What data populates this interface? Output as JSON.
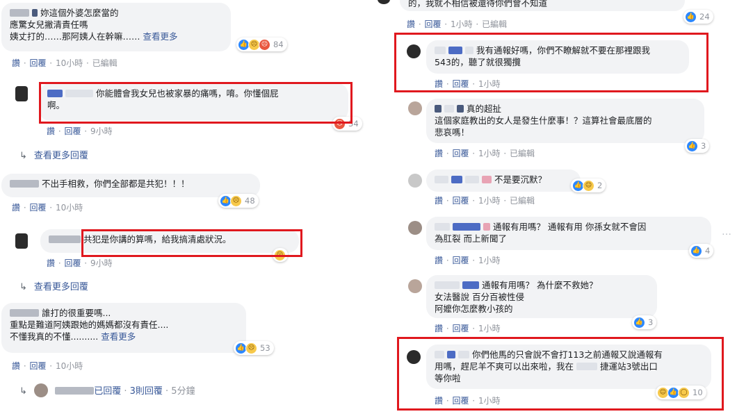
{
  "left": {
    "c1": {
      "lines": [
        "妳這個外婆怎麼當的",
        "應驚女兒撇清責任嗎",
        "姨丈打的……那阿姨人在幹嘛……"
      ],
      "see_more": "查看更多",
      "reaction_count": "84",
      "actions": {
        "like": "讚",
        "reply": "回覆",
        "time": "10小時",
        "edited": "已編輯"
      }
    },
    "c2": {
      "lines": [
        "你能體會我女兒也被家暴的痛嗎，唷。你懂個屁",
        "啊。"
      ],
      "reaction_count": "34",
      "actions": {
        "like": "讚",
        "reply": "回覆",
        "time": "9小時"
      }
    },
    "more1": {
      "label": "查看更多回覆"
    },
    "c3": {
      "lines": [
        "不出手相救，你們全部都是共犯！！！"
      ],
      "reaction_count": "48",
      "actions": {
        "like": "讚",
        "reply": "回覆",
        "time": "10小時"
      }
    },
    "c4": {
      "lines": [
        "共犯是你講的算嗎，給我搞清處狀況。"
      ],
      "actions": {
        "like": "讚",
        "reply": "回覆",
        "time": "9小時"
      }
    },
    "more2": {
      "label": "查看更多回覆"
    },
    "c5": {
      "lines": [
        "誰打的很重要嗎...",
        "重點是難道阿姨跟她的媽媽都沒有責任....",
        "不懂我真的不懂.........."
      ],
      "see_more": "查看更多",
      "reaction_count": "53",
      "actions": {
        "like": "讚",
        "reply": "回覆",
        "time": "10小時"
      }
    },
    "replies": {
      "text": "已回覆",
      "count": "3則回覆",
      "time": "5分鐘"
    }
  },
  "right": {
    "c0": {
      "lines": [
        "的，我就不相信被還待你們會不知道"
      ],
      "reaction_count": "24",
      "actions": {
        "like": "讚",
        "reply": "回覆",
        "time": "1小時",
        "edited": "已編輯"
      }
    },
    "c1": {
      "lines": [
        "我有通報好嗎，你們不瞭解就不要在那裡跟我",
        "543的，聽了就很獨攬"
      ],
      "actions": {
        "like": "讚",
        "reply": "回覆",
        "time": "1小時"
      }
    },
    "c2": {
      "lines": [
        "真的超扯",
        "這個家庭教出的女人是發生什麼事！？這算社會最底層的",
        "悲哀嗎！"
      ],
      "reaction_count": "3",
      "actions": {
        "like": "讚",
        "reply": "回覆",
        "time": "1小時",
        "edited": "已編輯"
      }
    },
    "c3": {
      "lines": [
        "不是要沉默？"
      ],
      "reaction_count": "2",
      "actions": {
        "like": "讚",
        "reply": "回覆",
        "time": "1小時",
        "edited": "已編輯"
      }
    },
    "c4": {
      "lines": [
        "通報有用嗎？ 通報有用 你孫女就不會因",
        "為肛裂 而上新聞了"
      ],
      "reaction_count": "4",
      "actions": {
        "like": "讚",
        "reply": "回覆",
        "time": "1小時"
      }
    },
    "c5": {
      "lines": [
        "通報有用嗎？ 為什麼不救她？",
        "女法醫說 百分百被性侵",
        "阿嬤你怎麼教小孩的"
      ],
      "reaction_count": "3",
      "actions": {
        "like": "讚",
        "reply": "回覆",
        "time": "1小時"
      }
    },
    "c6": {
      "lines": [
        "你們他馬的只會說不會打113之前通報又說通報有",
        "用嗎，趕尼羊不爽可以出來啦，我在",
        "捷運站3號出口",
        "等你啦"
      ],
      "reaction_count": "10",
      "actions": {
        "like": "讚",
        "reply": "回覆",
        "time": "1小時"
      }
    }
  },
  "colors": {
    "highlight": "#e0181e",
    "link": "#385898",
    "bubble": "#f2f3f5",
    "like": "#2d88ff"
  }
}
